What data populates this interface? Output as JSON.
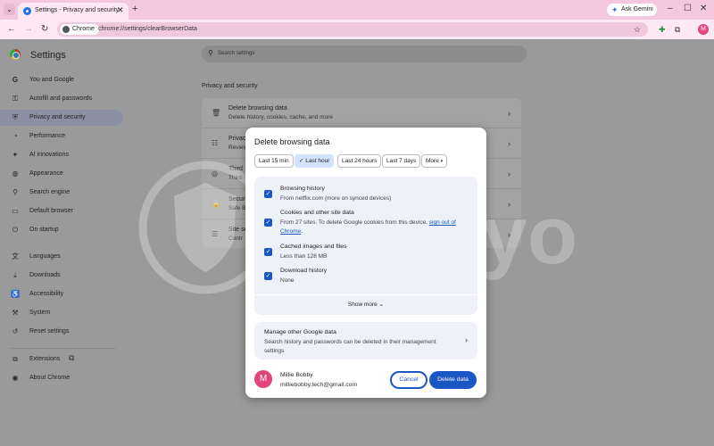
{
  "browser": {
    "tab_title": "Settings - Privacy and security",
    "ask_gemini": "Ask Gemini",
    "chip_label": "Chrome",
    "url": "chrome://settings/clearBrowserData",
    "profile_initial": "M"
  },
  "settings": {
    "title": "Settings",
    "search_placeholder": "Search settings",
    "section_title": "Privacy and security",
    "sidebar": [
      {
        "label": "You and Google",
        "icon": "google-icon"
      },
      {
        "label": "Autofill and passwords",
        "icon": "key-icon"
      },
      {
        "label": "Privacy and security",
        "icon": "shield-icon",
        "active": true
      },
      {
        "label": "Performance",
        "icon": "speedometer-icon"
      },
      {
        "label": "AI innovations",
        "icon": "sparkle-icon"
      },
      {
        "label": "Appearance",
        "icon": "palette-icon"
      },
      {
        "label": "Search engine",
        "icon": "search-icon"
      },
      {
        "label": "Default browser",
        "icon": "browser-icon"
      },
      {
        "label": "On startup",
        "icon": "power-icon"
      },
      {
        "label": "Languages",
        "icon": "translate-icon"
      },
      {
        "label": "Downloads",
        "icon": "download-icon"
      },
      {
        "label": "Accessibility",
        "icon": "accessibility-icon"
      },
      {
        "label": "System",
        "icon": "wrench-icon"
      },
      {
        "label": "Reset settings",
        "icon": "reset-icon"
      },
      {
        "label": "Extensions",
        "icon": "puzzle-icon"
      },
      {
        "label": "About Chrome",
        "icon": "chrome-icon"
      }
    ],
    "cards": [
      {
        "title": "Delete browsing data",
        "desc": "Delete history, cookies, cache, and more"
      },
      {
        "title": "Privac",
        "desc": "Review"
      },
      {
        "title": "Third",
        "desc": "Third"
      },
      {
        "title": "Securi",
        "desc": "Safe B"
      },
      {
        "title": "Site se",
        "desc": "Contr"
      }
    ]
  },
  "dialog": {
    "title": "Delete browsing data",
    "time_ranges": [
      "Last 15 min",
      "Last hour",
      "Last 24 hours",
      "Last 7 days",
      "More"
    ],
    "selected_range": "Last hour",
    "options": [
      {
        "title": "Browsing history",
        "desc": "From netflix.com (more on synced devices)",
        "checked": true
      },
      {
        "title": "Cookies and other site data",
        "desc": "From 27 sites. To delete Google cookies from this device, ",
        "link": "sign out of Chrome",
        "desc_end": ".",
        "checked": true
      },
      {
        "title": "Cached images and files",
        "desc": "Less than 128 MB",
        "checked": true
      },
      {
        "title": "Download history",
        "desc": "None",
        "checked": true
      }
    ],
    "show_more": "Show more",
    "manage_title": "Manage other Google data",
    "manage_desc": "Search history and passwords can be deleted in their management settings",
    "account_initial": "M",
    "account_name": "Millie Bobby",
    "account_email": "milliebobby.tech@gmail.com",
    "cancel": "Cancel",
    "delete": "Delete data"
  },
  "watermark": {
    "text": "safelyo"
  },
  "colors": {
    "accent": "#1a56c4",
    "tabbar": "#f4c9e0",
    "selected_chip": "#d3e3fd",
    "avatar": "#e0457b"
  }
}
